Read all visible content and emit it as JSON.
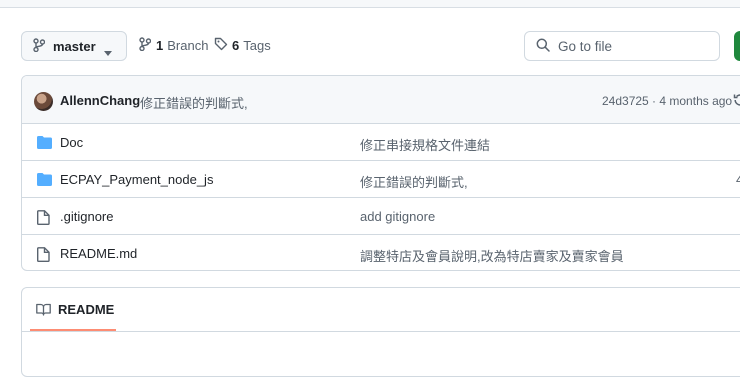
{
  "toolbar": {
    "branch_name": "master",
    "branch_count": "1",
    "branch_label": "Branch",
    "tag_count": "6",
    "tag_label": "Tags",
    "search_placeholder": "Go to file"
  },
  "commit": {
    "author": "AllennChang",
    "message": "修正錯誤的判斷式,",
    "meta": "24d3725 · 4 months ago"
  },
  "files": [
    {
      "name": "Doc",
      "type": "folder",
      "message": "修正串接規格文件連結",
      "date": ""
    },
    {
      "name": "ECPAY_Payment_node_js",
      "type": "folder",
      "message": "修正錯誤的判斷式,",
      "date": "4"
    },
    {
      "name": ".gitignore",
      "type": "file",
      "message": "add gitignore",
      "date": ""
    },
    {
      "name": "README.md",
      "type": "file",
      "message": "調整特店及會員說明,改為特店賣家及賣家會員",
      "date": ""
    }
  ],
  "readme": {
    "tab_label": "README"
  },
  "colors": {
    "folder": "#54aeff",
    "accent_tab": "#fd8c73",
    "code_button": "#1f883d"
  }
}
